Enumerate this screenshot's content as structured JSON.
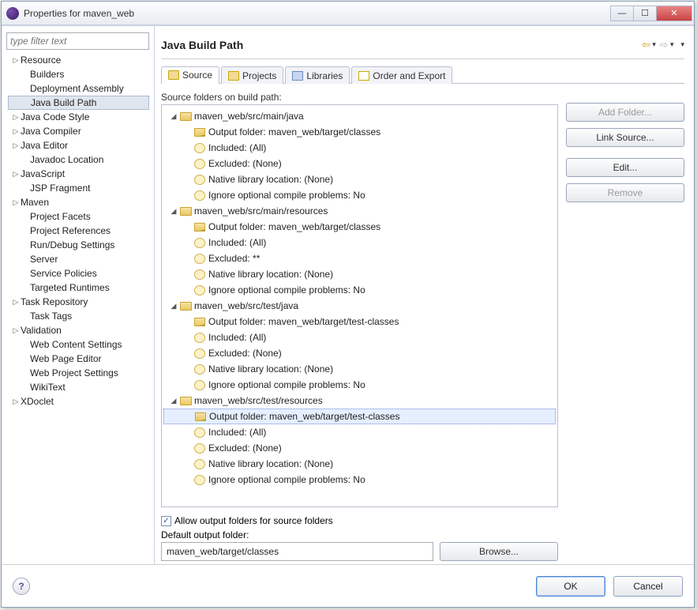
{
  "window": {
    "title": "Properties for maven_web"
  },
  "nav": {
    "filter_placeholder": "type filter text",
    "items": [
      {
        "label": "Resource",
        "tw": "▷",
        "lv": 1
      },
      {
        "label": "Builders",
        "tw": "",
        "lv": 2
      },
      {
        "label": "Deployment Assembly",
        "tw": "",
        "lv": 2
      },
      {
        "label": "Java Build Path",
        "tw": "",
        "lv": 2,
        "sel": true
      },
      {
        "label": "Java Code Style",
        "tw": "▷",
        "lv": 1
      },
      {
        "label": "Java Compiler",
        "tw": "▷",
        "lv": 1
      },
      {
        "label": "Java Editor",
        "tw": "▷",
        "lv": 1
      },
      {
        "label": "Javadoc Location",
        "tw": "",
        "lv": 2
      },
      {
        "label": "JavaScript",
        "tw": "▷",
        "lv": 1
      },
      {
        "label": "JSP Fragment",
        "tw": "",
        "lv": 2
      },
      {
        "label": "Maven",
        "tw": "▷",
        "lv": 1
      },
      {
        "label": "Project Facets",
        "tw": "",
        "lv": 2
      },
      {
        "label": "Project References",
        "tw": "",
        "lv": 2
      },
      {
        "label": "Run/Debug Settings",
        "tw": "",
        "lv": 2
      },
      {
        "label": "Server",
        "tw": "",
        "lv": 2
      },
      {
        "label": "Service Policies",
        "tw": "",
        "lv": 2
      },
      {
        "label": "Targeted Runtimes",
        "tw": "",
        "lv": 2
      },
      {
        "label": "Task Repository",
        "tw": "▷",
        "lv": 1
      },
      {
        "label": "Task Tags",
        "tw": "",
        "lv": 2
      },
      {
        "label": "Validation",
        "tw": "▷",
        "lv": 1
      },
      {
        "label": "Web Content Settings",
        "tw": "",
        "lv": 2
      },
      {
        "label": "Web Page Editor",
        "tw": "",
        "lv": 2
      },
      {
        "label": "Web Project Settings",
        "tw": "",
        "lv": 2
      },
      {
        "label": "WikiText",
        "tw": "",
        "lv": 2
      },
      {
        "label": "XDoclet",
        "tw": "▷",
        "lv": 1
      }
    ]
  },
  "page": {
    "title": "Java Build Path",
    "tabs": [
      {
        "label": "Source",
        "active": true
      },
      {
        "label": "Projects"
      },
      {
        "label": "Libraries"
      },
      {
        "label": "Order and Export"
      }
    ],
    "src_label": "Source folders on build path:",
    "folders": [
      {
        "path": "maven_web/src/main/java",
        "out": "Output folder: maven_web/target/classes",
        "inc": "Included: (All)",
        "exc": "Excluded: (None)",
        "nat": "Native library location: (None)",
        "ign": "Ignore optional compile problems: No"
      },
      {
        "path": "maven_web/src/main/resources",
        "out": "Output folder: maven_web/target/classes",
        "inc": "Included: (All)",
        "exc": "Excluded: **",
        "nat": "Native library location: (None)",
        "ign": "Ignore optional compile problems: No"
      },
      {
        "path": "maven_web/src/test/java",
        "out": "Output folder: maven_web/target/test-classes",
        "inc": "Included: (All)",
        "exc": "Excluded: (None)",
        "nat": "Native library location: (None)",
        "ign": "Ignore optional compile problems: No"
      },
      {
        "path": "maven_web/src/test/resources",
        "out": "Output folder: maven_web/target/test-classes",
        "out_sel": true,
        "inc": "Included: (All)",
        "exc": "Excluded: (None)",
        "nat": "Native library location: (None)",
        "ign": "Ignore optional compile problems: No"
      }
    ],
    "buttons": {
      "add": "Add Folder...",
      "link": "Link Source...",
      "edit": "Edit...",
      "remove": "Remove"
    },
    "allow_chk": "Allow output folders for source folders",
    "default_label": "Default output folder:",
    "default_value": "maven_web/target/classes",
    "browse": "Browse..."
  },
  "footer": {
    "ok": "OK",
    "cancel": "Cancel"
  }
}
